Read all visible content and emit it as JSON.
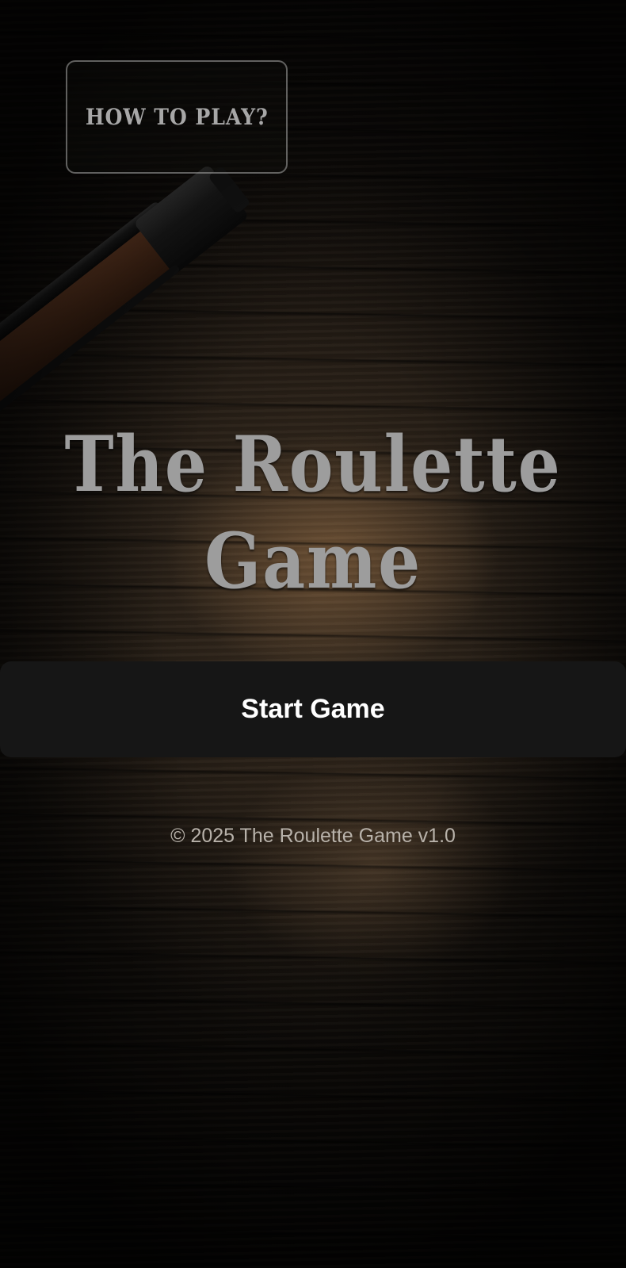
{
  "help_button": {
    "label": "HOW TO PLAY?"
  },
  "title": {
    "line1": "The Roulette",
    "line2": "Game"
  },
  "start_button": {
    "label": "Start Game"
  },
  "footer": {
    "text": "© 2025 The Roulette Game v1.0"
  },
  "background": {
    "image": "wooden-table-with-shotgun"
  },
  "colors": {
    "title": "#9d9d9d",
    "help_label": "#a7a7a7",
    "start_button_bg": "#161616",
    "start_button_text": "#ffffff",
    "footer_text": "#b8b2aa"
  }
}
